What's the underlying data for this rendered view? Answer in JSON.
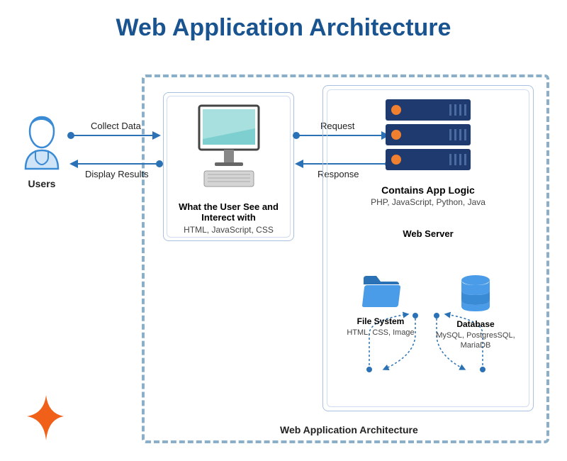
{
  "title": "Web Application Architecture",
  "users_label": "Users",
  "arrows": {
    "collect": "Collect Data",
    "display": "Display Results",
    "request": "Request",
    "response": "Response"
  },
  "client": {
    "title": "What the User See and Interect with",
    "subtitle": "HTML, JavaScript, CSS"
  },
  "server": {
    "title": "Contains App Logic",
    "subtitle": "PHP, JavaScript, Python, Java",
    "webserver_label": "Web Server"
  },
  "filesystem": {
    "title": "File System",
    "subtitle": "HTML, CSS, Image"
  },
  "database": {
    "title": "Database",
    "subtitle": "MySQL, PostgresSQL, MariaDB"
  },
  "arch_label": "Web Application Architecture"
}
